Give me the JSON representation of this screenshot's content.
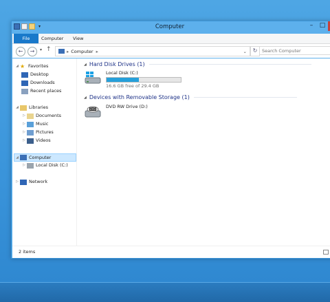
{
  "window": {
    "title": "Computer"
  },
  "ribbon": {
    "tabs": [
      "File",
      "Computer",
      "View"
    ]
  },
  "address": {
    "location": "Computer",
    "search_placeholder": "Search Computer"
  },
  "nav": {
    "favorites": "Favorites",
    "favorites_items": [
      "Desktop",
      "Downloads",
      "Recent places"
    ],
    "libraries": "Libraries",
    "libraries_items": [
      "Documents",
      "Music",
      "Pictures",
      "Videos"
    ],
    "computer": "Computer",
    "computer_items": [
      "Local Disk (C:)"
    ],
    "network": "Network"
  },
  "groups": {
    "hard_disk": "Hard Disk Drives (1)",
    "removable": "Devices with Removable Storage (1)"
  },
  "drives": {
    "c": {
      "name": "Local Disk (C:)",
      "free_text": "16.6 GB free of 29.4 GB",
      "used_fraction": 0.435
    },
    "d": {
      "name": "DVD RW Drive (D:)"
    }
  },
  "status": {
    "items": "2 items"
  },
  "colors": {
    "accent": "#1979ca",
    "fill": "#26a0da",
    "group_heading": "#1e3287"
  }
}
